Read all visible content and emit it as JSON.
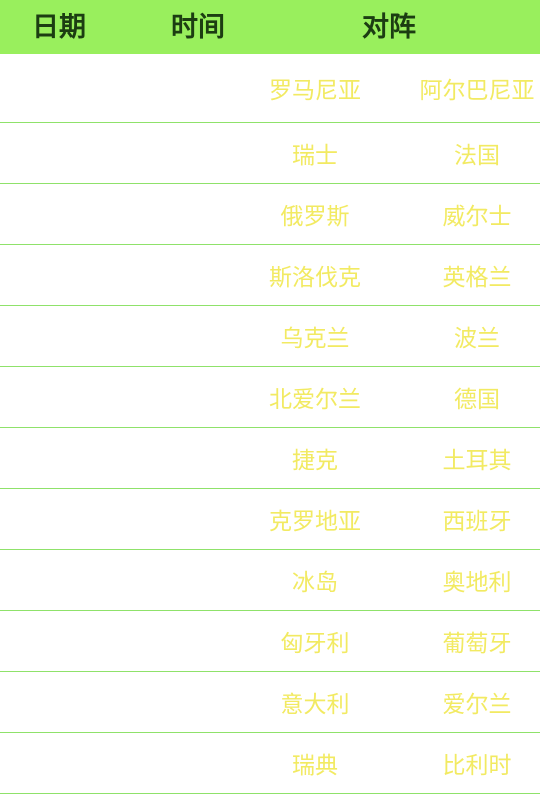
{
  "header": {
    "date": "日期",
    "time": "时间",
    "match": "对阵"
  },
  "matches": [
    {
      "home": "罗马尼亚",
      "away": "阿尔巴尼亚"
    },
    {
      "home": "瑞士",
      "away": "法国"
    },
    {
      "home": "俄罗斯",
      "away": "威尔士"
    },
    {
      "home": "斯洛伐克",
      "away": "英格兰"
    },
    {
      "home": "乌克兰",
      "away": "波兰"
    },
    {
      "home": "北爱尔兰",
      "away": "德国"
    },
    {
      "home": "捷克",
      "away": "土耳其"
    },
    {
      "home": "克罗地亚",
      "away": "西班牙"
    },
    {
      "home": "冰岛",
      "away": "奥地利"
    },
    {
      "home": "匈牙利",
      "away": "葡萄牙"
    },
    {
      "home": "意大利",
      "away": "爱尔兰"
    },
    {
      "home": "瑞典",
      "away": "比利时"
    }
  ],
  "colors": {
    "header_bg": "#99ef5d",
    "header_text": "#1c3d12",
    "team_text": "#f2ea62",
    "divider": "#8fe26a"
  }
}
